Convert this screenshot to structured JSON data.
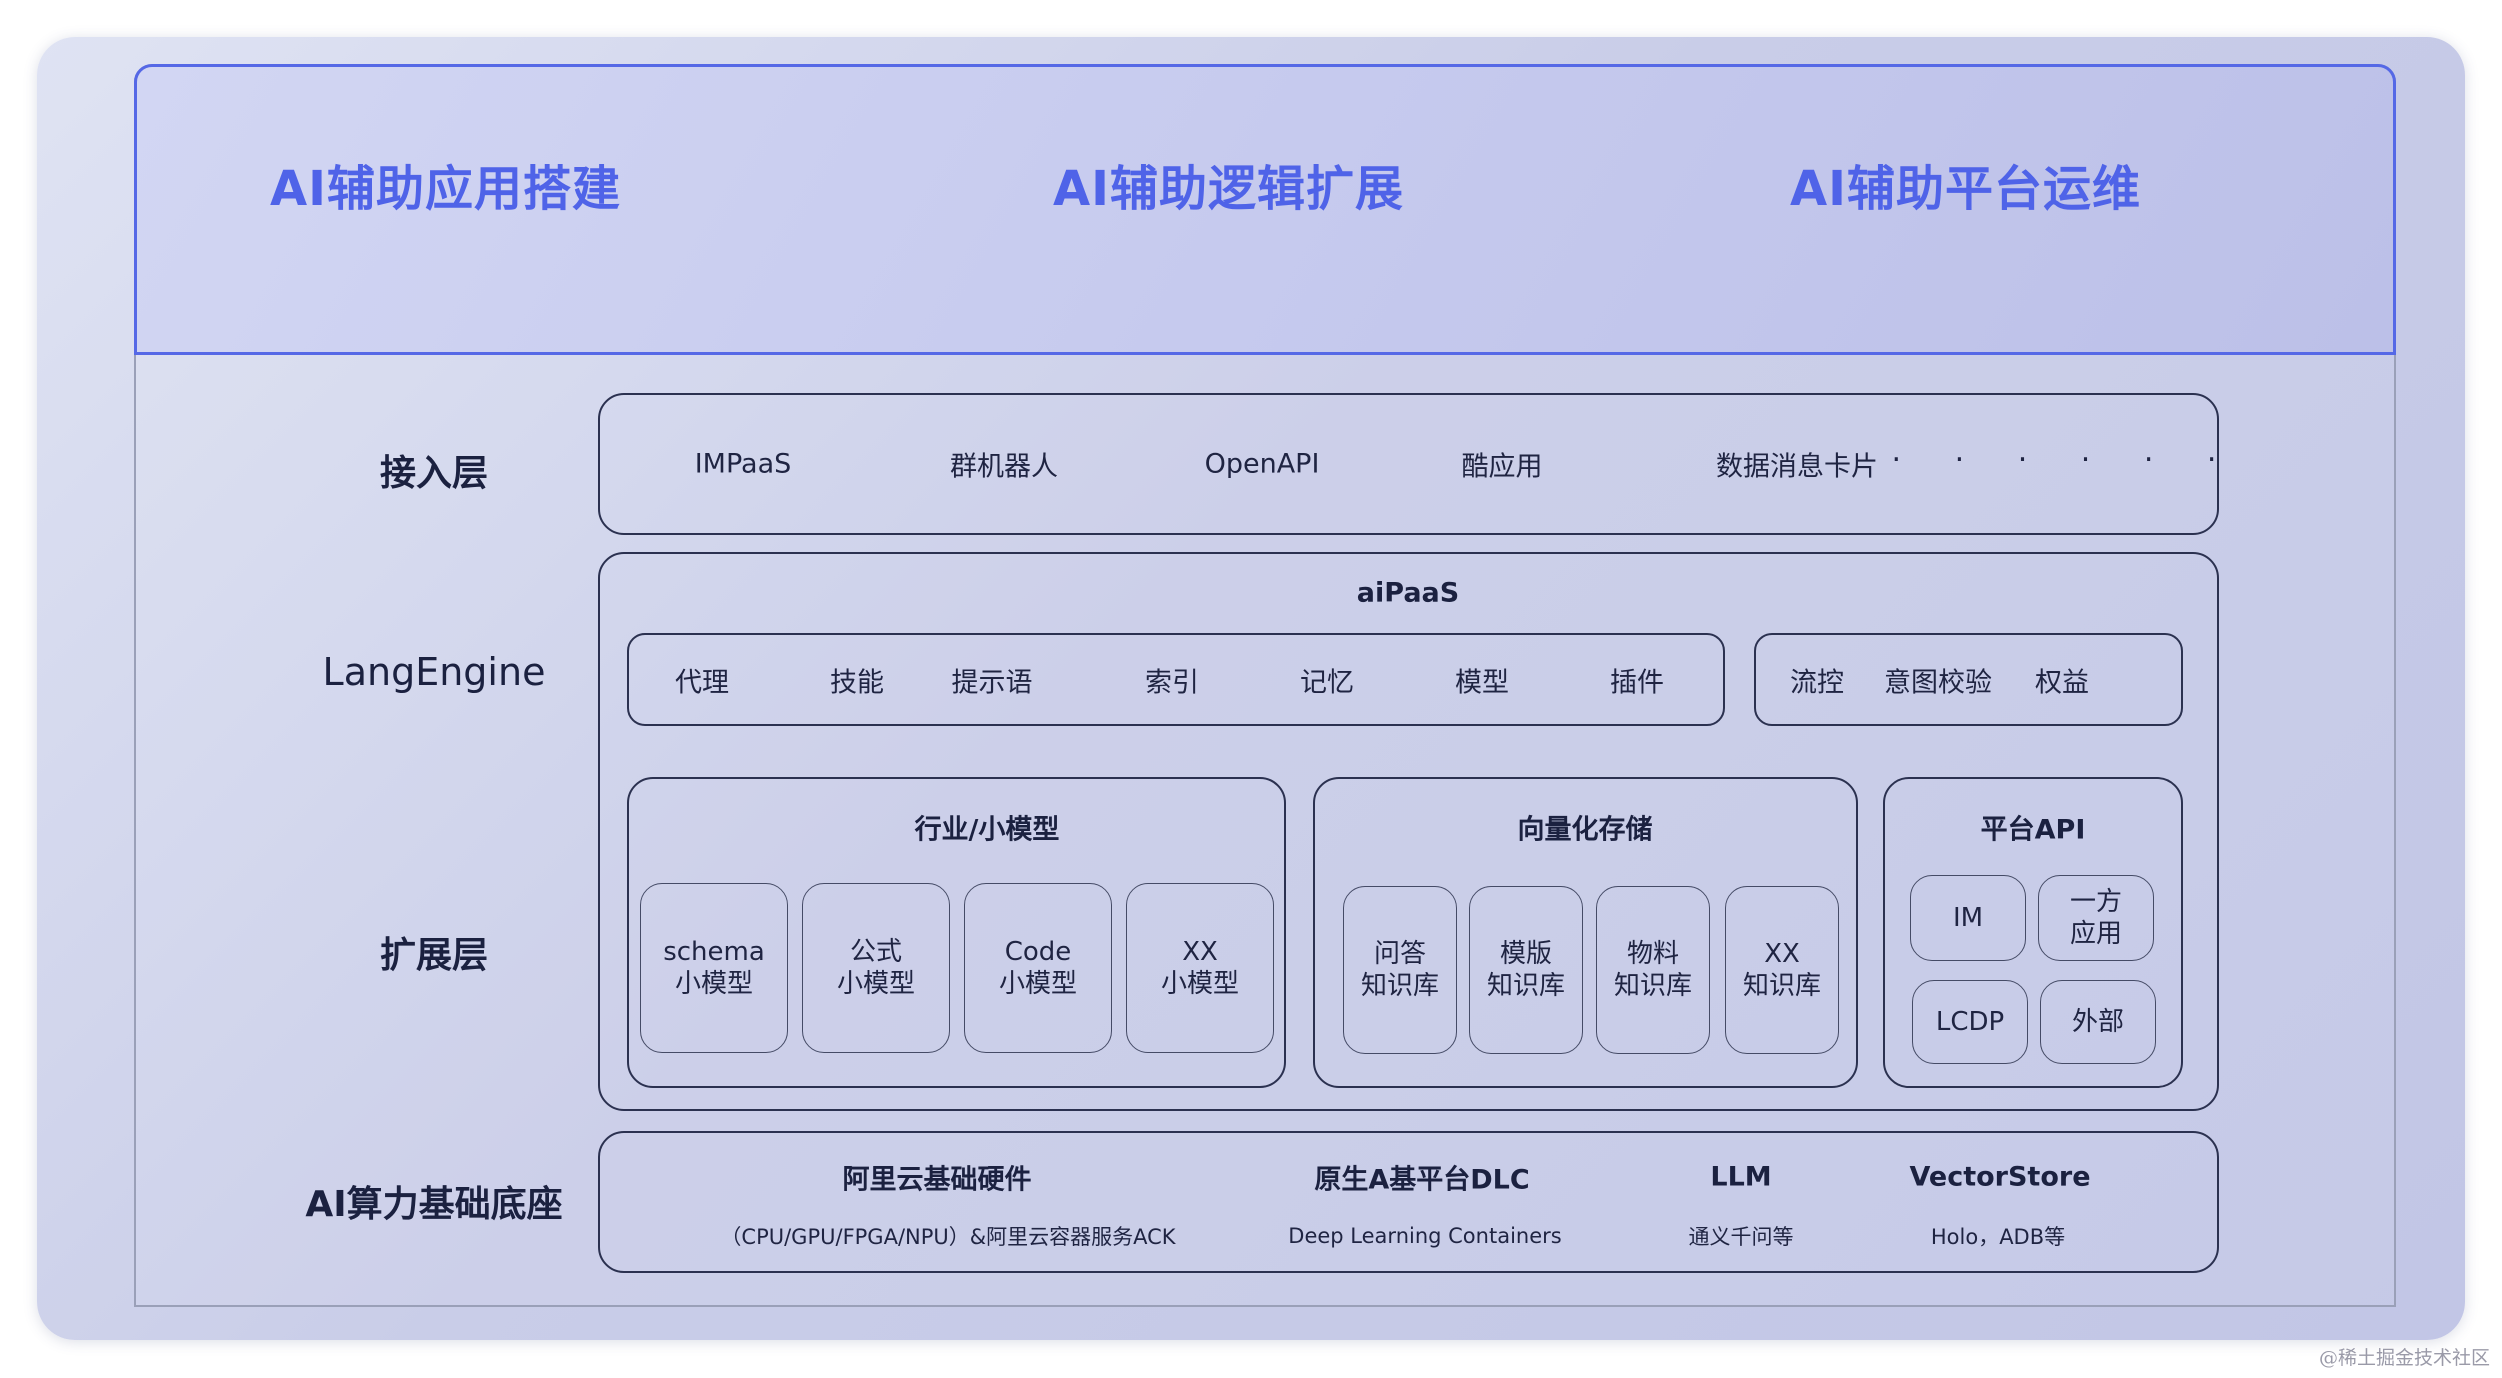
{
  "banner": {
    "titles": [
      "AI辅助应用搭建",
      "AI辅助逻辑扩展",
      "AI辅助平台运维"
    ]
  },
  "layers": {
    "access": "接入层",
    "langengine": "LangEngine",
    "extension": "扩展层",
    "foundation": "AI算力基础底座"
  },
  "access_row": {
    "items": [
      "IMPaaS",
      "群机器人",
      "OpenAPI",
      "酷应用",
      "数据消息卡片"
    ],
    "more": "· · · · · ·"
  },
  "aipaas": {
    "title": "aiPaaS",
    "modules": [
      "代理",
      "技能",
      "提示语",
      "索引",
      "记忆",
      "模型",
      "插件"
    ],
    "controls": [
      "流控",
      "意图校验",
      "权益"
    ]
  },
  "industry": {
    "title": "行业/小模型",
    "tiles": [
      [
        "schema",
        "小模型"
      ],
      [
        "公式",
        "小模型"
      ],
      [
        "Code",
        "小模型"
      ],
      [
        "XX",
        "小模型"
      ]
    ]
  },
  "vector": {
    "title": "向量化存储",
    "tiles": [
      [
        "问答",
        "知识库"
      ],
      [
        "模版",
        "知识库"
      ],
      [
        "物料",
        "知识库"
      ],
      [
        "XX",
        "知识库"
      ]
    ]
  },
  "platform_api": {
    "title": "平台API",
    "tiles": [
      [
        "IM"
      ],
      [
        "一方",
        "应用"
      ],
      [
        "LCDP"
      ],
      [
        "外部"
      ]
    ]
  },
  "foundation_row": {
    "items": [
      {
        "title": "阿里云基础硬件",
        "desc": "（CPU/GPU/FPGA/NPU）&阿里云容器服务ACK"
      },
      {
        "title": "原生A基平台DLC",
        "desc": "Deep Learning Containers"
      },
      {
        "title": "LLM",
        "desc": "通义千问等"
      },
      {
        "title": "VectorStore",
        "desc": "Holo，ADB等"
      }
    ]
  },
  "watermark": "@稀土掘金技术社区"
}
